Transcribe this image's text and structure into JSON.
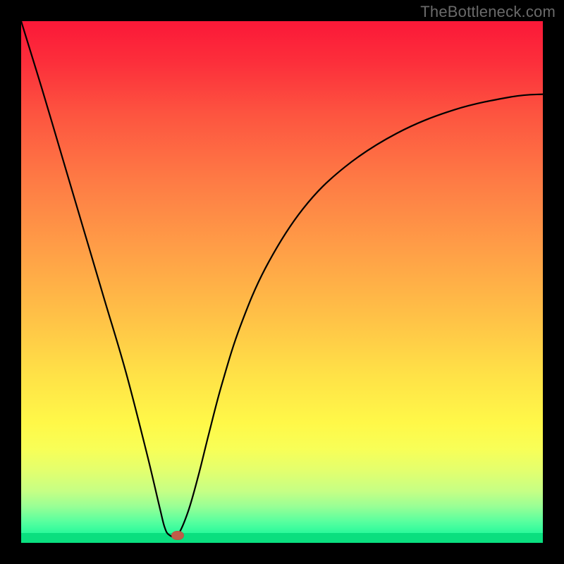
{
  "watermark": "TheBottleneck.com",
  "colors": {
    "frame": "#000000",
    "curve": "#000000",
    "marker": "#c05c49",
    "gradient_top": "#fb1838",
    "gradient_bottom": "#05ea8f",
    "bottom_band": "#0adf7f"
  },
  "chart_data": {
    "type": "line",
    "title": "",
    "xlabel": "",
    "ylabel": "",
    "xlim": [
      0,
      1
    ],
    "ylim": [
      0,
      1
    ],
    "legend": [],
    "annotations": [],
    "marker": {
      "x": 0.3,
      "y": 0.013
    },
    "series": [
      {
        "name": "curve",
        "x": [
          0.0,
          0.04,
          0.08,
          0.12,
          0.16,
          0.2,
          0.24,
          0.265,
          0.275,
          0.284,
          0.3,
          0.32,
          0.34,
          0.36,
          0.385,
          0.42,
          0.47,
          0.54,
          0.62,
          0.72,
          0.83,
          0.94,
          1.0
        ],
        "values": [
          1.0,
          0.87,
          0.735,
          0.6,
          0.465,
          0.33,
          0.175,
          0.07,
          0.03,
          0.015,
          0.015,
          0.06,
          0.13,
          0.21,
          0.305,
          0.415,
          0.53,
          0.64,
          0.72,
          0.785,
          0.83,
          0.855,
          0.86
        ]
      }
    ]
  }
}
